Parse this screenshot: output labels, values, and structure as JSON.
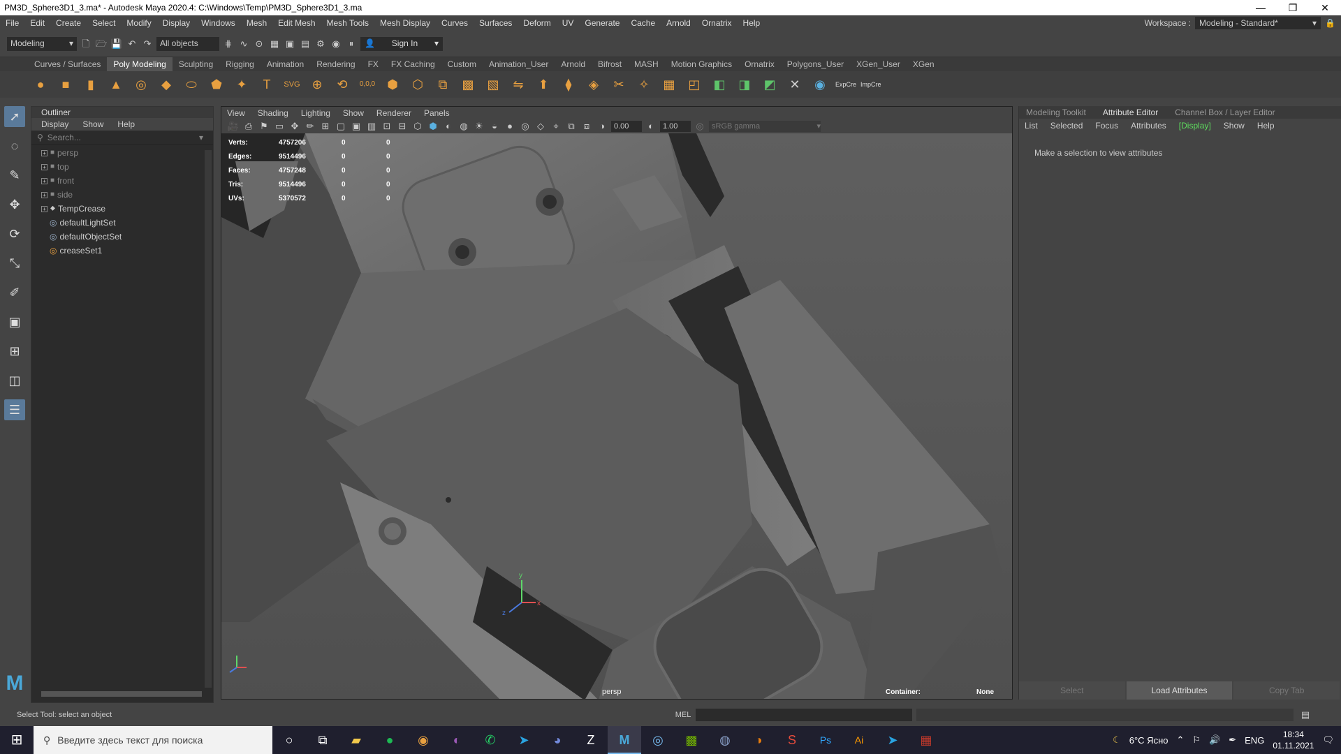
{
  "window": {
    "title": "PM3D_Sphere3D1_3.ma* - Autodesk Maya 2020.4: C:\\Windows\\Temp\\PM3D_Sphere3D1_3.ma"
  },
  "menubar": {
    "items": [
      "File",
      "Edit",
      "Create",
      "Select",
      "Modify",
      "Display",
      "Windows",
      "Mesh",
      "Edit Mesh",
      "Mesh Tools",
      "Mesh Display",
      "Curves",
      "Surfaces",
      "Deform",
      "UV",
      "Generate",
      "Cache",
      "Arnold",
      "Ornatrix",
      "Help"
    ],
    "workspace_label": "Workspace :",
    "workspace_value": "Modeling - Standard*"
  },
  "statusline": {
    "mode": "Modeling",
    "selection_mask": "All objects",
    "sign_in": "Sign In"
  },
  "shelf_tabs": {
    "items": [
      "Curves / Surfaces",
      "Poly Modeling",
      "Sculpting",
      "Rigging",
      "Animation",
      "Rendering",
      "FX",
      "FX Caching",
      "Custom",
      "Animation_User",
      "Arnold",
      "Bifrost",
      "MASH",
      "Motion Graphics",
      "Ornatrix",
      "Polygons_User",
      "XGen_User",
      "XGen"
    ],
    "active": "Poly Modeling"
  },
  "shelf": {
    "text_labels": [
      "T",
      "SVG",
      "0,0,0",
      "ExpCre",
      "ImpCre"
    ]
  },
  "outliner": {
    "title": "Outliner",
    "menu": [
      "Display",
      "Show",
      "Help"
    ],
    "search_placeholder": "Search...",
    "items": [
      {
        "label": "persp",
        "dim": true,
        "expandable": true
      },
      {
        "label": "top",
        "dim": true,
        "expandable": true
      },
      {
        "label": "front",
        "dim": true,
        "expandable": true
      },
      {
        "label": "side",
        "dim": true,
        "expandable": true
      },
      {
        "label": "TempCrease",
        "dim": false,
        "expandable": true
      },
      {
        "label": "defaultLightSet",
        "dim": false,
        "expandable": false
      },
      {
        "label": "defaultObjectSet",
        "dim": false,
        "expandable": false
      },
      {
        "label": "creaseSet1",
        "dim": false,
        "expandable": false
      }
    ]
  },
  "viewport": {
    "menu": [
      "View",
      "Shading",
      "Lighting",
      "Show",
      "Renderer",
      "Panels"
    ],
    "exposure": "0.00",
    "gamma": "1.00",
    "color_space": "sRGB gamma",
    "hud": [
      {
        "label": "Verts:",
        "v1": "4757206",
        "v2": "0",
        "v3": "0"
      },
      {
        "label": "Edges:",
        "v1": "9514496",
        "v2": "0",
        "v3": "0"
      },
      {
        "label": "Faces:",
        "v1": "4757248",
        "v2": "0",
        "v3": "0"
      },
      {
        "label": "Tris:",
        "v1": "9514496",
        "v2": "0",
        "v3": "0"
      },
      {
        "label": "UVs:",
        "v1": "5370572",
        "v2": "0",
        "v3": "0"
      }
    ],
    "camera": "persp",
    "container_label": "Container:",
    "container_value": "None",
    "axis_labels": {
      "x": "x",
      "y": "y",
      "z": "z"
    }
  },
  "attribute_editor": {
    "tabs": [
      "Modeling Toolkit",
      "Attribute Editor",
      "Channel Box / Layer Editor"
    ],
    "active_tab": "Attribute Editor",
    "menu": [
      "List",
      "Selected",
      "Focus",
      "Attributes",
      "[Display]",
      "Show",
      "Help"
    ],
    "message": "Make a selection to view attributes",
    "buttons": [
      "Select",
      "Load Attributes",
      "Copy Tab"
    ]
  },
  "helpline": {
    "text": "Select Tool: select an object",
    "mel_label": "MEL"
  },
  "taskbar": {
    "search_placeholder": "Введите здесь текст для поиска",
    "weather": "6°C Ясно",
    "language": "ENG",
    "time": "18:34",
    "date": "01.11.2021"
  }
}
